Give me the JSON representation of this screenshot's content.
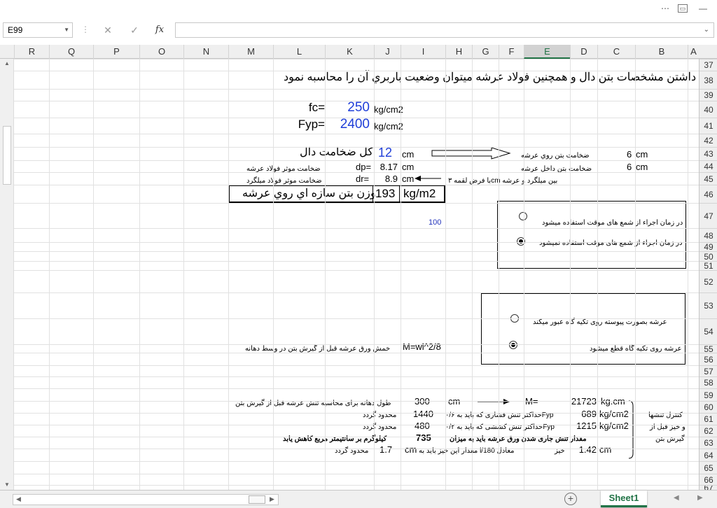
{
  "window": {
    "restore_icon": "ribbon-display-icon",
    "minimize": "—",
    "maximize": "□",
    "close": "✕"
  },
  "formula_bar": {
    "name_box": "E99",
    "cancel": "✕",
    "enter": "✓",
    "fx": "fx",
    "formula": ""
  },
  "columns": [
    "R",
    "Q",
    "P",
    "O",
    "N",
    "M",
    "L",
    "K",
    "J",
    "I",
    "H",
    "G",
    "F",
    "E",
    "D",
    "C",
    "B",
    "A"
  ],
  "selected_column": "E",
  "rows": [
    "37",
    "38",
    "39",
    "40",
    "41",
    "42",
    "43",
    "44",
    "45",
    "46",
    "47",
    "48",
    "49",
    "50",
    "51",
    "52",
    "53",
    "54",
    "55",
    "56",
    "57",
    "58",
    "59",
    "60",
    "61",
    "62",
    "63",
    "64",
    "65",
    "66",
    "67",
    "68"
  ],
  "cells": {
    "heading": "با داشتن مشخصات بتن دال و همچنين فولاد عرشه ميتوان وضعيت باربري آن را محاسبه نمود",
    "fc_label": "fc=",
    "fc_value": "250",
    "fc_unit": "kg/cm2",
    "fyp_label": "Fyp=",
    "fyp_value": "2400",
    "fyp_unit": "kg/cm2",
    "total_thickness_label": "كل ضخامت دال",
    "total_thickness_value": "12",
    "total_thickness_unit": "cm",
    "over_deck_label": "ضخامت بتن روي عرشه",
    "over_deck_value": "6",
    "over_deck_unit": "cm",
    "in_deck_label": "ضخامت بتن داخل عرشه",
    "in_deck_value": "6",
    "in_deck_unit": "cm",
    "dp_desc": "ضخامت موثر فولاد عرشه",
    "dp_label": "dp=",
    "dp_value": "8.17",
    "dp_unit": "cm",
    "dr_desc": "ضخامت موثر فولاد میلگرد",
    "dr_label": "dr=",
    "dr_value": "8.9",
    "dr_unit": "cm",
    "dr_note": "با فرض لقمه ۳cm بین میلگرد و عرشه",
    "weight_label": "وزن بتن سازه اي روي عرشه",
    "weight_value": "193",
    "weight_unit": "kg/m2",
    "value_100": "100",
    "radio1_a": "در زمان اجراء از شمع های موقت استفاده میشود",
    "radio1_b": "در زمان اجراء از شمع های موقت استفاده نمیشود",
    "radio2_a": "عرشه بصورت پیوسته روی تکیه گاه عبور میکند",
    "radio2_b": "عرشه روی تکیه گاه قطع میشود",
    "moment_desc": "خمش ورق عرشه قبل از گیرش بتن در وسط دهانه",
    "moment_formula": "M=wl^2/8",
    "span_desc": "طول دهانه برای محاسبه تنش عرشه قبل از گیرش بتن",
    "span_value": "300",
    "span_unit": "cm",
    "m_label": "M=",
    "m_value": "21723",
    "m_unit": "kg.cm",
    "comp_limit_desc": "محدود گردد",
    "comp_limit_value": "1440",
    "comp_stress_desc": "حداکثر تنش فشاری که باید به ۰/۶Fyp",
    "comp_stress_value": "689",
    "comp_stress_unit": "kg/cm2",
    "control_label": "کنترل تنشها",
    "tens_limit_desc": "محدود گردد",
    "tens_limit_value": "480",
    "tens_stress_desc": "حداکثر تنش کششی که باید به ۰/۲Fyp",
    "tens_stress_value": "1215",
    "tens_stress_unit": "kg/cm2",
    "control_label2": "و خیز قبل از",
    "reduce_desc": "کیلوگرم بر سانتیمتر مربع کاهش یابد",
    "reduce_value": "735",
    "reduce_label": "مقدار تنش جاری شدن ورق عرشه باید به میزان",
    "control_label3": "گیرش بتن",
    "defl_limit_desc": "محدود گردد",
    "defl_limit_value": "1.7",
    "defl_limit_unit": "cm",
    "defl_rule": "مقدار این خیز باید به l/180 معادل",
    "defl_label": "خیز",
    "defl_value": "1.42",
    "defl_unit": "cm"
  },
  "status": {
    "sheet_tab": "Sheet1",
    "add_sheet": "+",
    "prev": "◀",
    "next": "▶"
  },
  "colors": {
    "accent": "#217346",
    "blue_value": "#1f3ed8"
  }
}
